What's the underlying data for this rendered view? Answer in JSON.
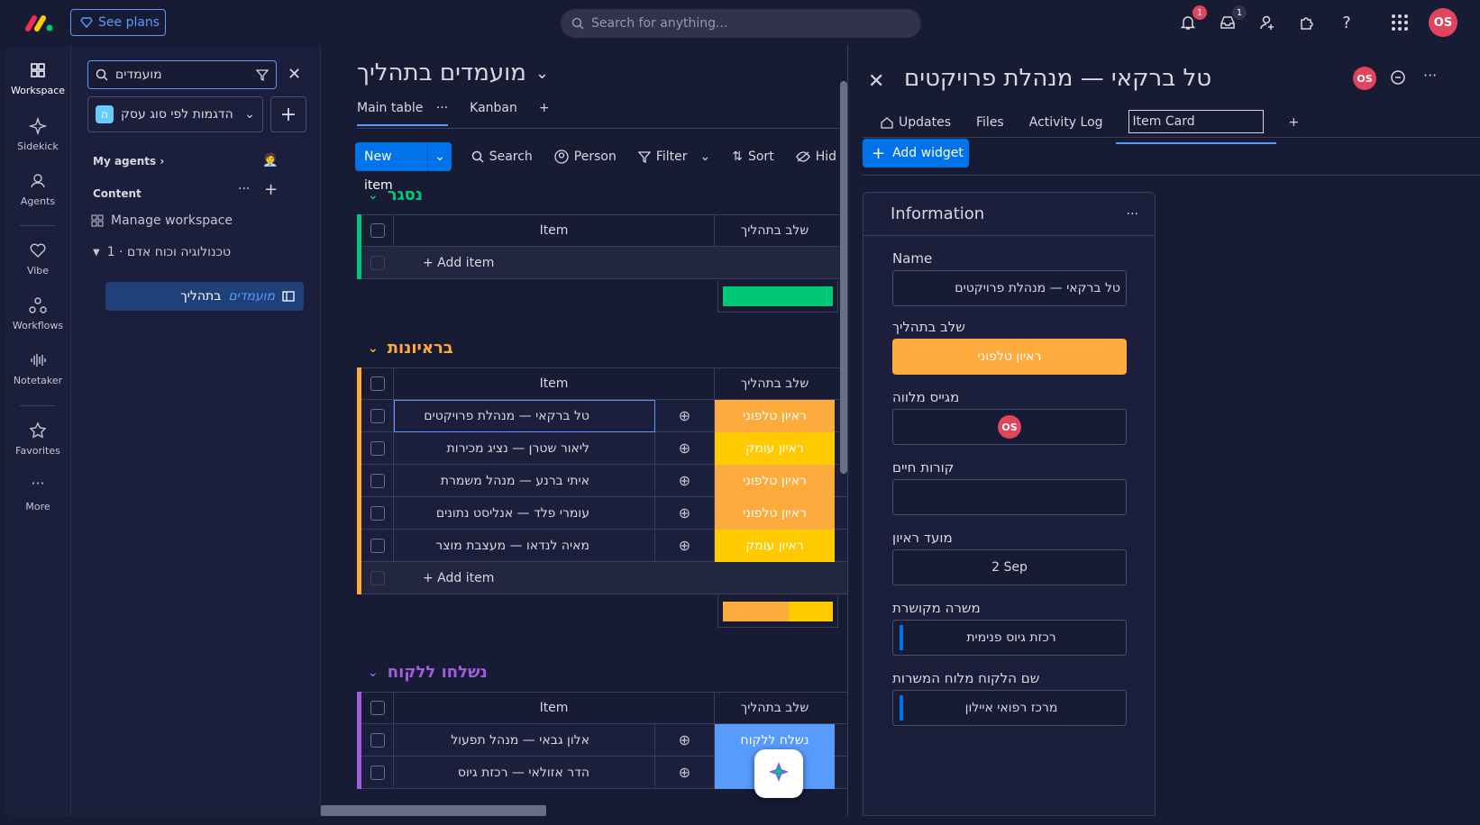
{
  "topbar": {
    "see_plans": "See plans",
    "search_placeholder": "Search for anything...",
    "notifications_count": "1",
    "inbox_count": "1",
    "user_initials": "OS"
  },
  "rail": {
    "items": [
      {
        "label": "Workspace",
        "icon": "grid-icon"
      },
      {
        "label": "Sidekick",
        "icon": "sparkle-icon"
      },
      {
        "label": "Agents",
        "icon": "agent-icon"
      },
      {
        "label": "Vibe",
        "icon": "heart-icon"
      },
      {
        "label": "Workflows",
        "icon": "workflow-icon"
      },
      {
        "label": "Notetaker",
        "icon": "waveform-icon"
      },
      {
        "label": "Favorites",
        "icon": "star-icon"
      },
      {
        "label": "More",
        "icon": "more-icon"
      }
    ]
  },
  "sidebar": {
    "search_value": "מועמדים",
    "workspace_name": "הדגמות לפי סוג עסק",
    "workspace_badge": "ה",
    "my_agents": "My agents",
    "content": "Content",
    "manage_workspace": "Manage workspace",
    "folder": "1 · טכנולוגיה וכוח אדם",
    "board_highlight": "מועמדים",
    "board_rest": "בתהליך"
  },
  "board": {
    "title": "מועמדים בתהליך",
    "tabs": [
      "Main table",
      "Kanban"
    ],
    "new_item": "New item",
    "toolbar": [
      "Search",
      "Person",
      "Filter",
      "Sort",
      "Hid"
    ],
    "item_header": "Item",
    "status_header": "שלב בתהליך",
    "add_item": "+ Add item",
    "groups": [
      {
        "title": "נסגר",
        "color": "#00c875",
        "rows": []
      },
      {
        "title": "בראיונות",
        "color": "#fdab3d",
        "rows": [
          {
            "name": "טל ברקאי — מנהלת פרויקטים",
            "status": "ראיון טלפוני",
            "status_color": "#fdab3d"
          },
          {
            "name": "ליאור שטרן — נציג מכירות",
            "status": "ראיון עומק",
            "status_color": "#ffcb00"
          },
          {
            "name": "איתי ברנע — מנהל משמרת",
            "status": "ראיון טלפוני",
            "status_color": "#fdab3d"
          },
          {
            "name": "עומרי פלד — אנליסט נתונים",
            "status": "ראיון טלפוני",
            "status_color": "#fdab3d"
          },
          {
            "name": "מאיה לנדאו — מעצבת מוצר",
            "status": "ראיון עומק",
            "status_color": "#ffcb00"
          }
        ]
      },
      {
        "title": "נשלחו ללקוח",
        "color": "#a25ddc",
        "rows": [
          {
            "name": "אלון גבאי — מנהל תפעול",
            "status": "נשלח ללקוח",
            "status_color": "#579bfc"
          },
          {
            "name": "הדר אזולאי — רכזת גיוס",
            "status": "נ...",
            "status_color": "#579bfc"
          }
        ]
      }
    ]
  },
  "panel": {
    "title": "טל ברקאי — מנהלת פרויקטים",
    "avatar": "OS",
    "tabs": [
      "Updates",
      "Files",
      "Activity Log"
    ],
    "tab_input_value": "Item Card",
    "add_widget": "Add widget",
    "info_title": "Information",
    "fields": {
      "name_label": "Name",
      "name_value": "טל ברקאי — מנהלת פרויקטים",
      "stage_label": "שלב בתהליך",
      "stage_value": "ראיון טלפוני",
      "recruiter_label": "מגייס מלווה",
      "recruiter_avatar": "OS",
      "cv_label": "קורות חיים",
      "interview_label": "מועד ראיון",
      "interview_value": "2 Sep",
      "job_label": "משרה מקושרת",
      "job_value": "רכזת גיוס פנימית",
      "client_label": "שם הלקוח מלוח המשרות",
      "client_value": "מרכז רפואי איילון"
    }
  }
}
